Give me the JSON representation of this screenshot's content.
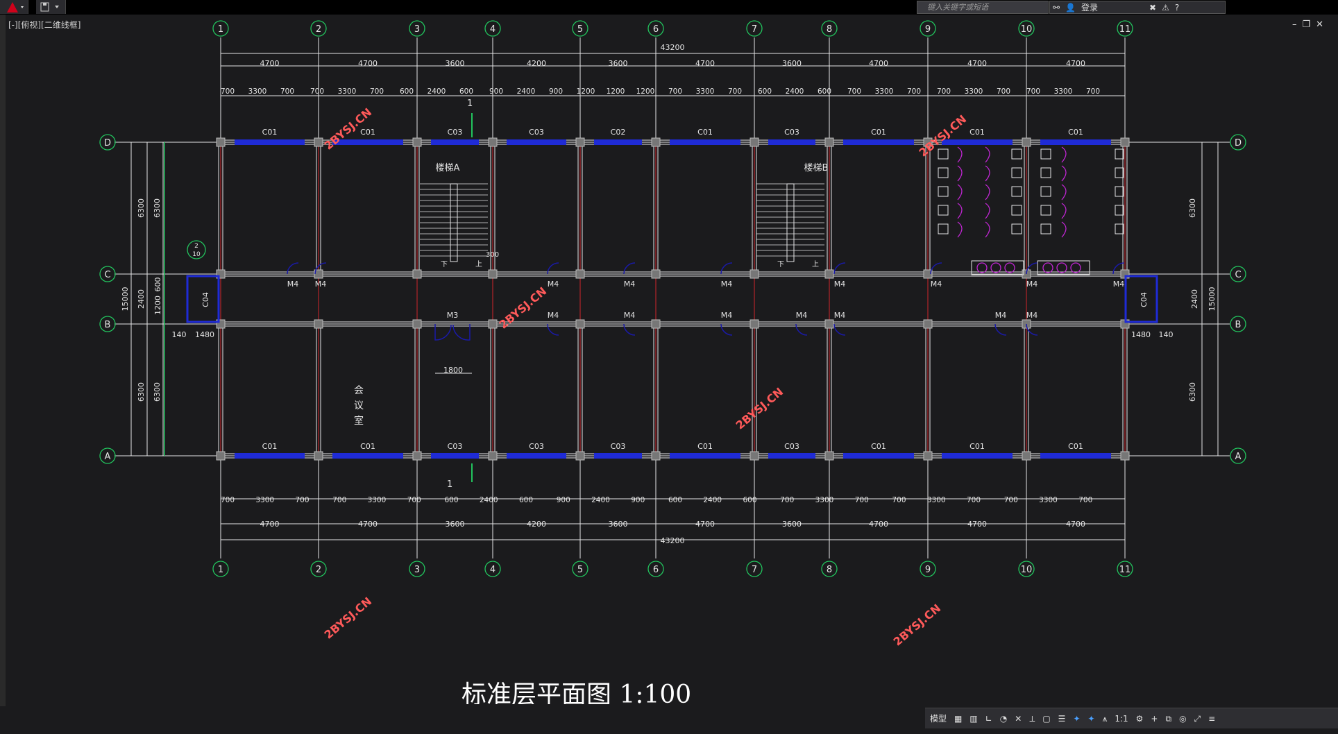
{
  "app": {
    "title_field_placeholder": "键入关键字或短语",
    "login_label": "登录",
    "help_icon": "help-icon"
  },
  "viewport": {
    "label": "[-][俯视][二维线框]"
  },
  "drawing": {
    "title": "标准层平面图 1:100",
    "axis_columns": [
      "1",
      "2",
      "3",
      "4",
      "5",
      "6",
      "7",
      "8",
      "9",
      "10",
      "11"
    ],
    "axis_rows": [
      "D",
      "C",
      "B",
      "A"
    ],
    "overall_dim": "43200",
    "bay_dims_top": [
      "4700",
      "4700",
      "3600",
      "4200",
      "3600",
      "4700",
      "3600",
      "4700",
      "4700",
      "4700"
    ],
    "bay_dims_bottom": [
      "4700",
      "4700",
      "3600",
      "4200",
      "3600",
      "4700",
      "3600",
      "4700",
      "4700",
      "4700"
    ],
    "detail_dims_top": [
      "700",
      "3300",
      "700",
      "700",
      "3300",
      "700",
      "600",
      "2400",
      "600",
      "900",
      "2400",
      "900",
      "1200",
      "1200",
      "1200",
      "700",
      "3300",
      "700",
      "600",
      "2400",
      "600",
      "700",
      "3300",
      "700",
      "700",
      "3300",
      "700",
      "700",
      "3300",
      "700"
    ],
    "detail_dims_bottom": [
      "700",
      "3300",
      "700",
      "700",
      "3300",
      "700",
      "600",
      "2400",
      "600",
      "900",
      "2400",
      "900",
      "600",
      "2400",
      "600",
      "700",
      "3300",
      "700",
      "700",
      "3300",
      "700",
      "700",
      "3300",
      "700"
    ],
    "vertical_dims": {
      "d_c": "6300",
      "c_b": "2400",
      "b_a": "6300",
      "total": "15000",
      "inner_600": "600",
      "inner_1200": "1200"
    },
    "windows_top": [
      "C01",
      "C01",
      "C03",
      "C03",
      "C02",
      "C01",
      "C03",
      "C01",
      "C01",
      "C01"
    ],
    "windows_bottom": [
      "C01",
      "C01",
      "C03",
      "C03",
      "C03",
      "C01",
      "C03",
      "C01",
      "C01",
      "C01"
    ],
    "windows_side": "C04",
    "doors": "M4",
    "door_m3": "M3",
    "dim_1800": "1800",
    "dim_140": "140",
    "dim_1480": "1480",
    "stair_a": "楼梯A",
    "stair_b": "楼梯B",
    "room_meeting": [
      "会",
      "议",
      "室"
    ],
    "section_mark": "1",
    "detail_ref": {
      "top": "2",
      "bottom": "10"
    },
    "stair_up": "上",
    "stair_down": "下",
    "stair_300": "300",
    "watermark": "2BYSJ.CN"
  },
  "status": {
    "model_tab": "模型",
    "scale": "1:1"
  }
}
